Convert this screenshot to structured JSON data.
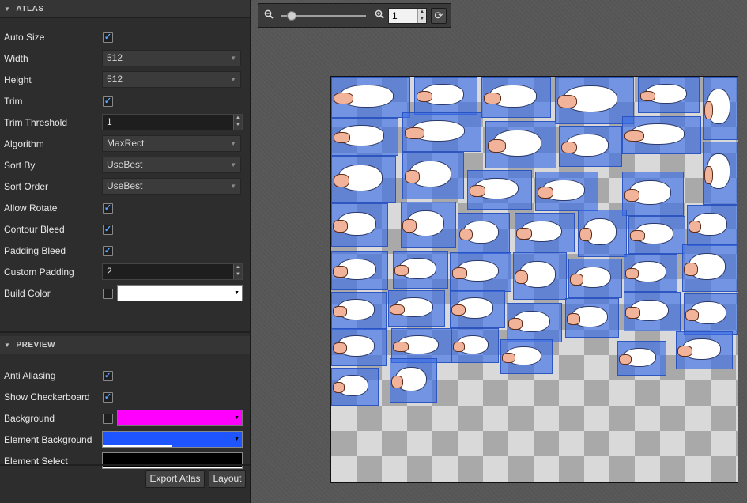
{
  "atlas": {
    "header": "ATLAS",
    "rows": [
      {
        "label": "Auto Size",
        "type": "check",
        "checked": true
      },
      {
        "label": "Width",
        "type": "select",
        "value": "512"
      },
      {
        "label": "Height",
        "type": "select",
        "value": "512"
      },
      {
        "label": "Trim",
        "type": "check",
        "checked": true
      },
      {
        "label": "Trim Threshold",
        "type": "spin",
        "value": "1"
      },
      {
        "label": "Algorithm",
        "type": "select",
        "value": "MaxRect"
      },
      {
        "label": "Sort By",
        "type": "select",
        "value": "UseBest"
      },
      {
        "label": "Sort Order",
        "type": "select",
        "value": "UseBest"
      },
      {
        "label": "Allow Rotate",
        "type": "check",
        "checked": true
      },
      {
        "label": "Contour Bleed",
        "type": "check",
        "checked": true
      },
      {
        "label": "Padding Bleed",
        "type": "check",
        "checked": true
      },
      {
        "label": "Custom Padding",
        "type": "spin",
        "value": "2"
      },
      {
        "label": "Build Color",
        "type": "color",
        "checked": false,
        "color": "#ffffff"
      }
    ]
  },
  "preview": {
    "header": "PREVIEW",
    "rows": [
      {
        "label": "Anti Aliasing",
        "type": "check",
        "checked": true
      },
      {
        "label": "Show Checkerboard",
        "type": "check",
        "checked": true
      },
      {
        "label": "Background",
        "type": "color",
        "checked": false,
        "color": "#ff00ff"
      },
      {
        "label": "Element Background",
        "type": "colorfull",
        "color": "#1f55ff"
      },
      {
        "label": "Element Select",
        "type": "colorfull",
        "color": "#000000"
      }
    ]
  },
  "buttons": {
    "export": "Export Atlas",
    "layout": "Layout"
  },
  "toolbar": {
    "zoom_value": "1",
    "zoom_out_icon": "zoom-out-icon",
    "zoom_in_icon": "zoom-in-icon",
    "refresh_icon": "refresh-icon"
  },
  "colors": {
    "panel": "#2d2d2d",
    "sprite_bg": "#3c6ee6",
    "accent": "#5aa6ff"
  }
}
